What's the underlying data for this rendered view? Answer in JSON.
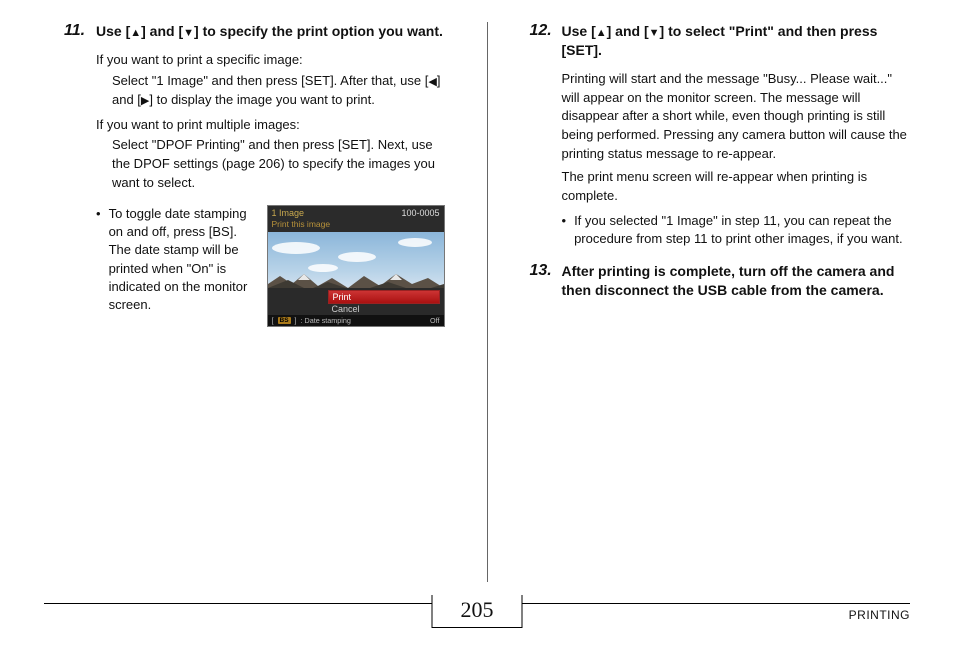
{
  "glyphs": {
    "up": "▲",
    "down": "▼",
    "left": "◀",
    "right": "▶"
  },
  "step11": {
    "number": "11.",
    "title_pre": "Use [",
    "title_mid1": "] and [",
    "title_post": "] to specify the print option you want.",
    "body1": "If you want to print a specific image:",
    "body1a_pre": "Select \"1 Image\" and then press [SET]. After that, use [",
    "body1a_mid": "] and [",
    "body1a_post": "] to display the image you want to print.",
    "body2": "If you want to print multiple images:",
    "body2a": "Select \"DPOF Printing\" and then press [SET]. Next, use the DPOF settings (page 206) to specify the images you want to select.",
    "bullet": "To toggle date stamping on and off, press [BS]. The date stamp will be printed when \"On\" is indicated on the monitor screen."
  },
  "lcd": {
    "top_left1": "1 Image",
    "top_left2": "Print this image",
    "top_right": "100-0005",
    "menu_print": "Print",
    "menu_cancel": "Cancel",
    "bs_label": "BS",
    "datestamp_label": ": Date stamping",
    "datestamp_value": "Off"
  },
  "step12": {
    "number": "12.",
    "title_pre": "Use [",
    "title_mid1": "] and [",
    "title_post": "] to select \"Print\" and then press [SET].",
    "body1": "Printing will start and the message \"Busy... Please wait...\" will appear on the monitor screen. The message will disappear after a short while, even though printing is still being performed. Pressing any camera button will cause the printing status message to re-appear.",
    "body2": "The print menu screen will re-appear when printing is complete.",
    "bullet": "If you selected \"1 Image\" in step 11, you can repeat the procedure from step 11 to print other images, if you want."
  },
  "step13": {
    "number": "13.",
    "title": "After printing is complete, turn off the camera and then disconnect the USB cable from the camera."
  },
  "footer": {
    "page_number": "205",
    "section": "PRINTING"
  }
}
